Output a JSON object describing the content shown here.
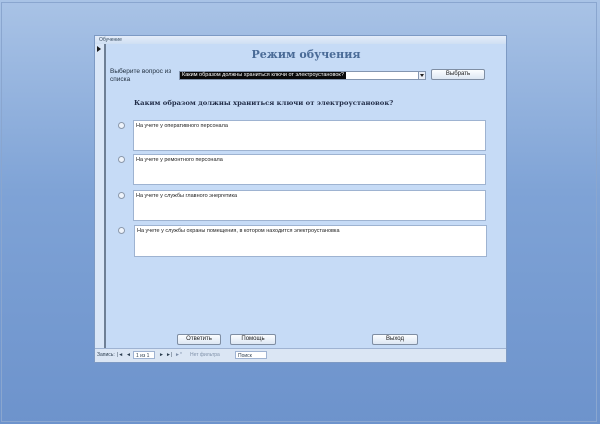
{
  "window": {
    "title": "Обучение"
  },
  "form": {
    "title": "Режим обучения",
    "combo_label": "Выберите вопрос из списка",
    "combo_value": "Каким образом должны храниться ключи от электроустановок?",
    "select_button": "Выбрать",
    "question": "Каким образом должны храниться ключи от электроустановок?",
    "answers": [
      "На учете у оперативного персонала",
      "На учете у ремонтного персонала",
      "На учете у службы главного энергетика",
      "На учете у службы охраны помещения, в котором находится электроустановка"
    ],
    "answer_button": "Ответить",
    "help_button": "Помощь",
    "exit_button": "Выход"
  },
  "navbar": {
    "record_label": "Запись:",
    "first": "|◄",
    "prev": "◄",
    "current": "1 из 1",
    "next": "►",
    "last": "►|",
    "new": "►*",
    "filter": "Нет фильтра",
    "search": "Поиск"
  }
}
